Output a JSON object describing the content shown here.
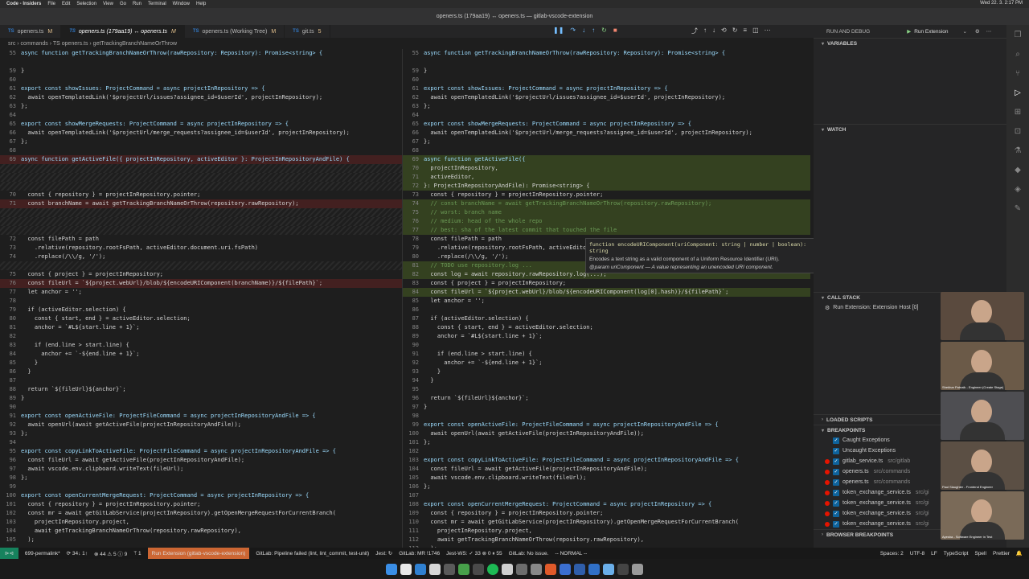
{
  "menubar": {
    "app": "Code - Insiders",
    "items": [
      "File",
      "Edit",
      "Selection",
      "View",
      "Go",
      "Run",
      "Terminal",
      "Window",
      "Help"
    ],
    "clock": "Wed 22. 3. 2:17 PM"
  },
  "titlebar": {
    "title": "openers.ts (179aa19) ↔ openers.ts — gitlab-vscode-extension"
  },
  "tabs": [
    {
      "label": "openers.ts",
      "badge": "M",
      "active": false
    },
    {
      "label": "openers.ts (179aa19) ↔ openers.ts",
      "badge": "M",
      "active": true
    },
    {
      "label": "openers.ts (Working Tree)",
      "badge": "M",
      "active": false
    },
    {
      "label": "git.ts",
      "badge": "5",
      "active": false
    }
  ],
  "breadcrumb": "src › commands › TS openers.ts › getTrackingBranchNameOrThrow",
  "left_lines": [
    {
      "n": "55",
      "t": "async function getTrackingBranchNameOrThrow(rawRepository: Repository): Promise<string> {",
      "c": ""
    },
    {
      "n": "",
      "t": "",
      "c": ""
    },
    {
      "n": "59",
      "t": "}",
      "c": ""
    },
    {
      "n": "60",
      "t": "",
      "c": ""
    },
    {
      "n": "61",
      "t": "export const showIssues: ProjectCommand = async projectInRepository => {",
      "c": ""
    },
    {
      "n": "62",
      "t": "  await openTemplatedLink('$projectUrl/issues?assignee_id=$userId', projectInRepository);",
      "c": ""
    },
    {
      "n": "63",
      "t": "};",
      "c": ""
    },
    {
      "n": "64",
      "t": "",
      "c": ""
    },
    {
      "n": "65",
      "t": "export const showMergeRequests: ProjectCommand = async projectInRepository => {",
      "c": ""
    },
    {
      "n": "66",
      "t": "  await openTemplatedLink('$projectUrl/merge_requests?assignee_id=$userId', projectInRepository);",
      "c": ""
    },
    {
      "n": "67",
      "t": "};",
      "c": ""
    },
    {
      "n": "68",
      "t": "",
      "c": ""
    },
    {
      "n": "69",
      "t": "async function getActiveFile({ projectInRepository, activeEditor }: ProjectInRepositoryAndFile) {",
      "c": "del"
    },
    {
      "n": "",
      "t": "",
      "c": "hatch"
    },
    {
      "n": "",
      "t": "",
      "c": "hatch"
    },
    {
      "n": "",
      "t": "",
      "c": "hatch"
    },
    {
      "n": "70",
      "t": "  const { repository } = projectInRepository.pointer;",
      "c": ""
    },
    {
      "n": "71",
      "t": "  const branchName = await getTrackingBranchNameOrThrow(repository.rawRepository);",
      "c": "del"
    },
    {
      "n": "",
      "t": "",
      "c": "hatch"
    },
    {
      "n": "",
      "t": "",
      "c": "hatch"
    },
    {
      "n": "",
      "t": "",
      "c": "hatch"
    },
    {
      "n": "72",
      "t": "  const filePath = path",
      "c": ""
    },
    {
      "n": "73",
      "t": "    .relative(repository.rootFsPath, activeEditor.document.uri.fsPath)",
      "c": ""
    },
    {
      "n": "74",
      "t": "    .replace(/\\\\/g, '/');",
      "c": ""
    },
    {
      "n": "",
      "t": "",
      "c": "hatch"
    },
    {
      "n": "75",
      "t": "  const { project } = projectInRepository;",
      "c": ""
    },
    {
      "n": "76",
      "t": "  const fileUrl = `${project.webUrl}/blob/${encodeURIComponent(branchName)}/${filePath}`;",
      "c": "del"
    },
    {
      "n": "77",
      "t": "  let anchor = '';",
      "c": ""
    },
    {
      "n": "78",
      "t": "",
      "c": ""
    },
    {
      "n": "79",
      "t": "  if (activeEditor.selection) {",
      "c": ""
    },
    {
      "n": "80",
      "t": "    const { start, end } = activeEditor.selection;",
      "c": ""
    },
    {
      "n": "81",
      "t": "    anchor = `#L${start.line + 1}`;",
      "c": ""
    },
    {
      "n": "82",
      "t": "",
      "c": ""
    },
    {
      "n": "83",
      "t": "    if (end.line > start.line) {",
      "c": ""
    },
    {
      "n": "84",
      "t": "      anchor += `-${end.line + 1}`;",
      "c": ""
    },
    {
      "n": "85",
      "t": "    }",
      "c": ""
    },
    {
      "n": "86",
      "t": "  }",
      "c": ""
    },
    {
      "n": "87",
      "t": "",
      "c": ""
    },
    {
      "n": "88",
      "t": "  return `${fileUrl}${anchor}`;",
      "c": ""
    },
    {
      "n": "89",
      "t": "}",
      "c": ""
    },
    {
      "n": "90",
      "t": "",
      "c": ""
    },
    {
      "n": "91",
      "t": "export const openActiveFile: ProjectFileCommand = async projectInRepositoryAndFile => {",
      "c": ""
    },
    {
      "n": "92",
      "t": "  await openUrl(await getActiveFile(projectInRepositoryAndFile));",
      "c": ""
    },
    {
      "n": "93",
      "t": "};",
      "c": ""
    },
    {
      "n": "94",
      "t": "",
      "c": ""
    },
    {
      "n": "95",
      "t": "export const copyLinkToActiveFile: ProjectFileCommand = async projectInRepositoryAndFile => {",
      "c": ""
    },
    {
      "n": "96",
      "t": "  const fileUrl = await getActiveFile(projectInRepositoryAndFile);",
      "c": ""
    },
    {
      "n": "97",
      "t": "  await vscode.env.clipboard.writeText(fileUrl);",
      "c": ""
    },
    {
      "n": "98",
      "t": "};",
      "c": ""
    },
    {
      "n": "99",
      "t": "",
      "c": ""
    },
    {
      "n": "100",
      "t": "export const openCurrentMergeRequest: ProjectCommand = async projectInRepository => {",
      "c": ""
    },
    {
      "n": "101",
      "t": "  const { repository } = projectInRepository.pointer;",
      "c": ""
    },
    {
      "n": "102",
      "t": "  const mr = await getGitLabService(projectInRepository).getOpenMergeRequestForCurrentBranch(",
      "c": ""
    },
    {
      "n": "103",
      "t": "    projectInRepository.project,",
      "c": ""
    },
    {
      "n": "104",
      "t": "    await getTrackingBranchNameOrThrow(repository.rawRepository),",
      "c": ""
    },
    {
      "n": "105",
      "t": "  );",
      "c": ""
    }
  ],
  "right_lines": [
    {
      "n": "55",
      "t": "async function getTrackingBranchNameOrThrow(rawRepository: Repository): Promise<string> {",
      "c": ""
    },
    {
      "n": "",
      "t": "",
      "c": ""
    },
    {
      "n": "59",
      "t": "}",
      "c": ""
    },
    {
      "n": "60",
      "t": "",
      "c": ""
    },
    {
      "n": "61",
      "t": "export const showIssues: ProjectCommand = async projectInRepository => {",
      "c": ""
    },
    {
      "n": "62",
      "t": "  await openTemplatedLink('$projectUrl/issues?assignee_id=$userId', projectInRepository);",
      "c": ""
    },
    {
      "n": "63",
      "t": "};",
      "c": ""
    },
    {
      "n": "64",
      "t": "",
      "c": ""
    },
    {
      "n": "65",
      "t": "export const showMergeRequests: ProjectCommand = async projectInRepository => {",
      "c": ""
    },
    {
      "n": "66",
      "t": "  await openTemplatedLink('$projectUrl/merge_requests?assignee_id=$userId', projectInRepository);",
      "c": ""
    },
    {
      "n": "67",
      "t": "};",
      "c": ""
    },
    {
      "n": "68",
      "t": "",
      "c": ""
    },
    {
      "n": "69",
      "t": "async function getActiveFile({",
      "c": "add"
    },
    {
      "n": "70",
      "t": "  projectInRepository,",
      "c": "add"
    },
    {
      "n": "71",
      "t": "  activeEditor,",
      "c": "add"
    },
    {
      "n": "72",
      "t": "}: ProjectInRepositoryAndFile): Promise<string> {",
      "c": "add"
    },
    {
      "n": "73",
      "t": "  const { repository } = projectInRepository.pointer;",
      "c": ""
    },
    {
      "n": "74",
      "t": "  // const branchName = await getTrackingBranchNameOrThrow(repository.rawRepository);",
      "c": "add"
    },
    {
      "n": "75",
      "t": "  // worst: branch name",
      "c": "add"
    },
    {
      "n": "76",
      "t": "  // medium: head of the whole repo",
      "c": "add"
    },
    {
      "n": "77",
      "t": "  // best: sha of the latest commit that touched the file",
      "c": "add"
    },
    {
      "n": "78",
      "t": "  const filePath = path",
      "c": ""
    },
    {
      "n": "79",
      "t": "    .relative(repository.rootFsPath, activeEditor.document.uri.fsPath)",
      "c": ""
    },
    {
      "n": "80",
      "t": "    .replace(/\\\\/g, '/');",
      "c": ""
    },
    {
      "n": "81",
      "t": "  // TODO use repository.log ...",
      "c": "add"
    },
    {
      "n": "82",
      "t": "  const log = await repository.rawRepository.log(...);",
      "c": "add"
    },
    {
      "n": "83",
      "t": "  const { project } = projectInRepository;",
      "c": ""
    },
    {
      "n": "84",
      "t": "  const fileUrl = `${project.webUrl}/blob/${encodeURIComponent(log[0].hash)}/${filePath}`;",
      "c": "add"
    },
    {
      "n": "85",
      "t": "  let anchor = '';",
      "c": ""
    },
    {
      "n": "86",
      "t": "",
      "c": ""
    },
    {
      "n": "87",
      "t": "  if (activeEditor.selection) {",
      "c": ""
    },
    {
      "n": "88",
      "t": "    const { start, end } = activeEditor.selection;",
      "c": ""
    },
    {
      "n": "89",
      "t": "    anchor = `#L${start.line + 1}`;",
      "c": ""
    },
    {
      "n": "90",
      "t": "",
      "c": ""
    },
    {
      "n": "91",
      "t": "    if (end.line > start.line) {",
      "c": ""
    },
    {
      "n": "92",
      "t": "      anchor += `-${end.line + 1}`;",
      "c": ""
    },
    {
      "n": "93",
      "t": "    }",
      "c": ""
    },
    {
      "n": "94",
      "t": "  }",
      "c": ""
    },
    {
      "n": "95",
      "t": "",
      "c": ""
    },
    {
      "n": "96",
      "t": "  return `${fileUrl}${anchor}`;",
      "c": ""
    },
    {
      "n": "97",
      "t": "}",
      "c": ""
    },
    {
      "n": "98",
      "t": "",
      "c": ""
    },
    {
      "n": "99",
      "t": "export const openActiveFile: ProjectFileCommand = async projectInRepositoryAndFile => {",
      "c": ""
    },
    {
      "n": "100",
      "t": "  await openUrl(await getActiveFile(projectInRepositoryAndFile));",
      "c": ""
    },
    {
      "n": "101",
      "t": "};",
      "c": ""
    },
    {
      "n": "102",
      "t": "",
      "c": ""
    },
    {
      "n": "103",
      "t": "export const copyLinkToActiveFile: ProjectFileCommand = async projectInRepositoryAndFile => {",
      "c": ""
    },
    {
      "n": "104",
      "t": "  const fileUrl = await getActiveFile(projectInRepositoryAndFile);",
      "c": ""
    },
    {
      "n": "105",
      "t": "  await vscode.env.clipboard.writeText(fileUrl);",
      "c": ""
    },
    {
      "n": "106",
      "t": "};",
      "c": ""
    },
    {
      "n": "107",
      "t": "",
      "c": ""
    },
    {
      "n": "108",
      "t": "export const openCurrentMergeRequest: ProjectCommand = async projectInRepository => {",
      "c": ""
    },
    {
      "n": "109",
      "t": "  const { repository } = projectInRepository.pointer;",
      "c": ""
    },
    {
      "n": "110",
      "t": "  const mr = await getGitLabService(projectInRepository).getOpenMergeRequestForCurrentBranch(",
      "c": ""
    },
    {
      "n": "111",
      "t": "    projectInRepository.project,",
      "c": ""
    },
    {
      "n": "112",
      "t": "    await getTrackingBranchNameOrThrow(repository.rawRepository),",
      "c": ""
    },
    {
      "n": "113",
      "t": "  );",
      "c": ""
    }
  ],
  "hover": {
    "signature": "function encodeURIComponent(uriComponent: string | number | boolean): string",
    "description": "Encodes a text string as a valid component of a Uniform Resource Identifier (URI).",
    "param": "@param uriComponent — A value representing an unencoded URI component."
  },
  "sidebar": {
    "title": "RUN AND DEBUG",
    "config": "Run Extension",
    "variables": "VARIABLES",
    "watch": "WATCH",
    "callstack": "CALL STACK",
    "callstack_item": "Run Extension: Extension Host [0]",
    "loaded_scripts": "LOADED SCRIPTS",
    "breakpoints": "BREAKPOINTS",
    "browser_breakpoints": "BROWSER BREAKPOINTS",
    "bp_items": [
      {
        "label": "Caught Exceptions",
        "path": "",
        "dot": false
      },
      {
        "label": "Uncaught Exceptions",
        "path": "",
        "dot": false
      },
      {
        "label": "gitlab_service.ts",
        "path": "src/gitlab",
        "dot": true
      },
      {
        "label": "openers.ts",
        "path": "src/commands",
        "dot": true
      },
      {
        "label": "openers.ts",
        "path": "src/commands",
        "dot": true
      },
      {
        "label": "token_exchange_service.ts",
        "path": "src/gi",
        "dot": true
      },
      {
        "label": "token_exchange_service.ts",
        "path": "src/gi",
        "dot": true
      },
      {
        "label": "token_exchange_service.ts",
        "path": "src/gi",
        "dot": true
      },
      {
        "label": "token_exchange_service.ts",
        "path": "src/gi",
        "dot": true
      }
    ]
  },
  "videos": [
    {
      "caption": "",
      "color": "#5a4a3e"
    },
    {
      "caption": "Shekhar Patnaik - Engineer (Create Stage)",
      "color": "#6b5a48"
    },
    {
      "caption": "",
      "color": "#4e4e52"
    },
    {
      "caption": "Paul Slaughter - Frontend Engineer",
      "color": "#5b4f44"
    },
    {
      "caption": "Ayesha - Software Engineer in Test",
      "color": "#7a6a58"
    }
  ],
  "statusbar": {
    "branch": "699-permalink*",
    "sync": "⟳ 34↓ 1↑",
    "problems": "⊗ 44 ⚠ 5 ⓘ 9",
    "ports": "ᛘ 1",
    "debug": "Run Extension (gitlab-vscode-extension)",
    "pipeline": "GitLab: Pipeline failed (lint, lint_commit, test-unit)",
    "jest": "Jest: ↻",
    "mr": "GitLab: MR !1746",
    "jestws": "Jest-WS: ✓ 33 ⊗ 0 ⏸ 55",
    "issue": "GitLab: No issue.",
    "mode": "-- NORMAL --",
    "spaces": "Spaces: 2",
    "encoding": "UTF-8",
    "eol": "LF",
    "lang": "TypeScript",
    "spell": "Spell",
    "prettier": "Prettier"
  },
  "accent": "#007acc"
}
